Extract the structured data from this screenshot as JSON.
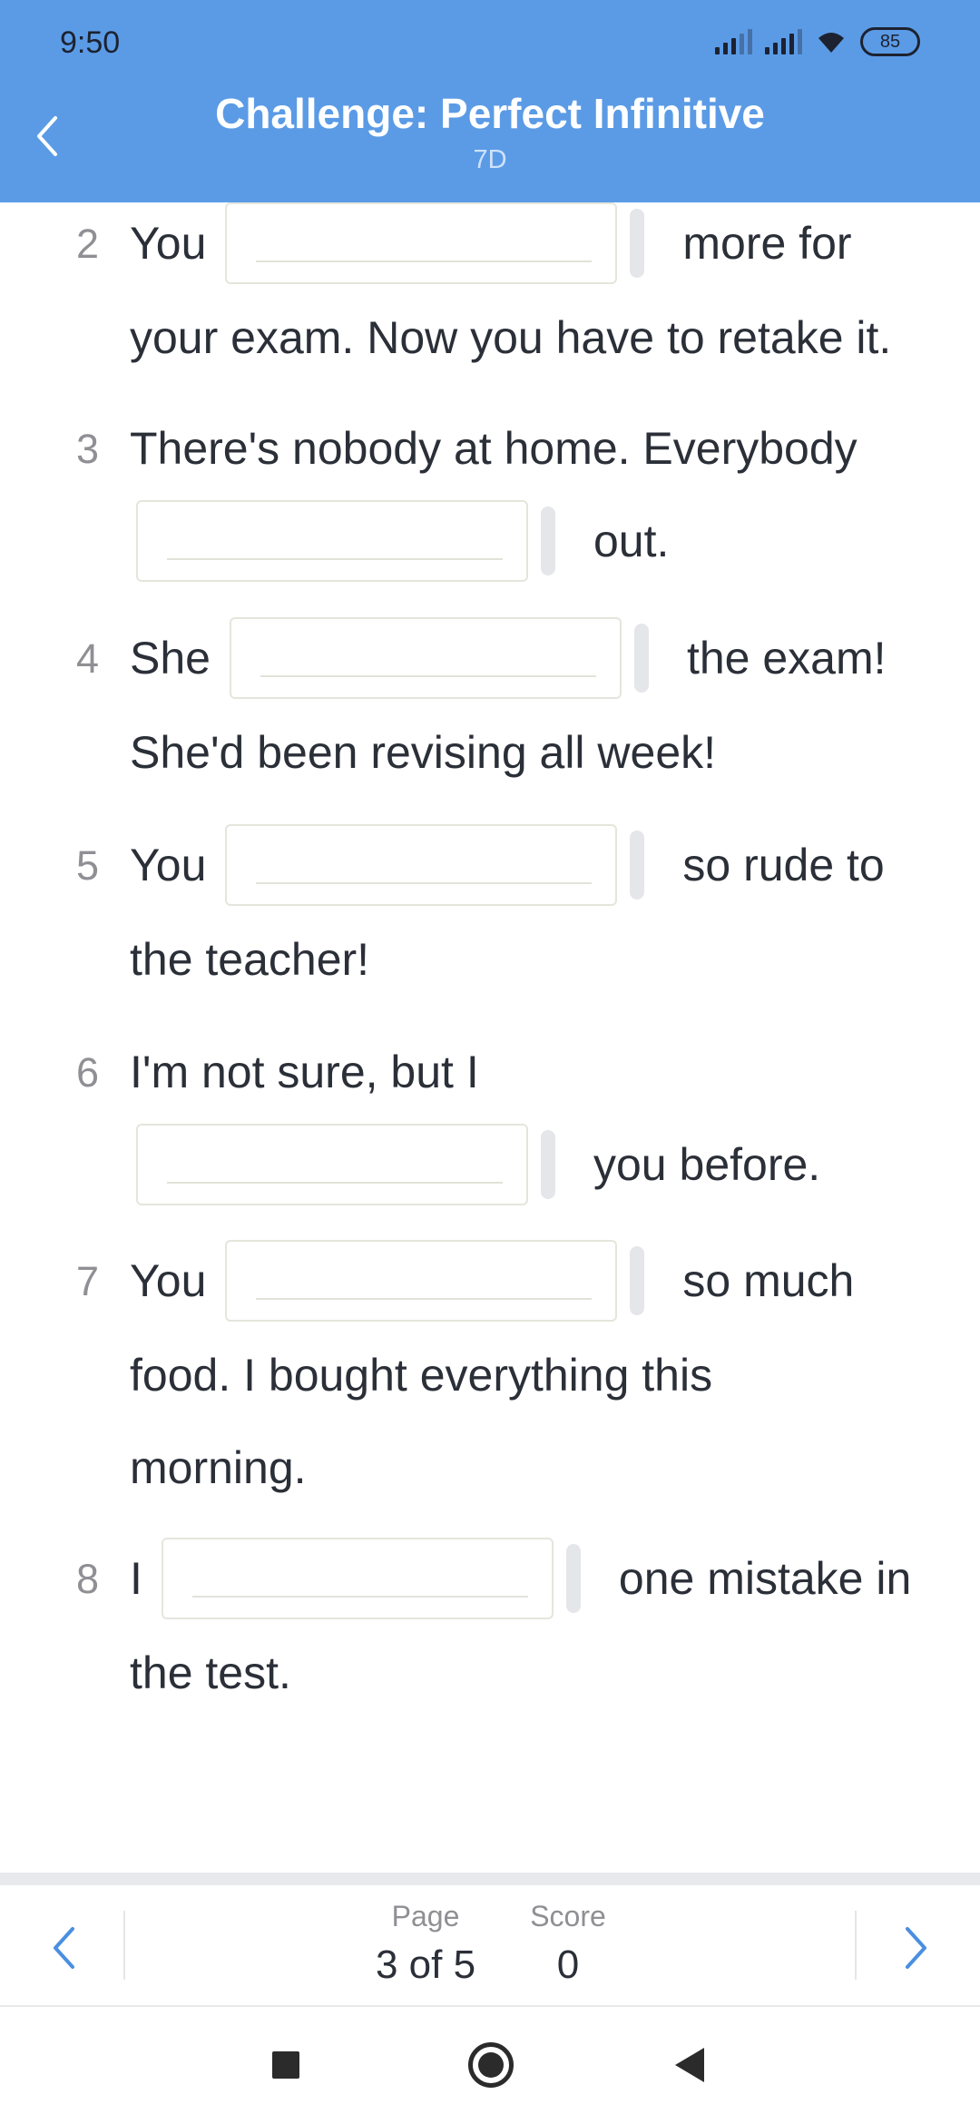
{
  "status_bar": {
    "time": "9:50",
    "battery": "85"
  },
  "header": {
    "title": "Challenge: Perfect Infinitive",
    "subtitle": "7D"
  },
  "questions": [
    {
      "num": "2",
      "pre": "You",
      "post": "more for",
      "rest": [
        "your exam. Now you have to retake it."
      ],
      "answer": ""
    },
    {
      "num": "3",
      "pre_lines": [
        "There's nobody at home. Everybody"
      ],
      "post": "out.",
      "answer": ""
    },
    {
      "num": "4",
      "pre": "She",
      "post": "the exam!",
      "rest": [
        "She'd been revising all week!"
      ],
      "answer": ""
    },
    {
      "num": "5",
      "pre": "You",
      "post": "so rude to",
      "rest": [
        "the teacher!"
      ],
      "answer": ""
    },
    {
      "num": "6",
      "pre_lines": [
        "I'm not sure, but I"
      ],
      "post": "you before.",
      "answer": ""
    },
    {
      "num": "7",
      "pre": "You",
      "post": "so much",
      "rest": [
        "food. I bought everything this",
        "morning."
      ],
      "answer": ""
    },
    {
      "num": "8",
      "pre": "I",
      "post": "one mistake in",
      "rest": [
        "the test."
      ],
      "answer": ""
    }
  ],
  "pager": {
    "page_label": "Page",
    "page_value": "3 of 5",
    "score_label": "Score",
    "score_value": "0"
  },
  "colors": {
    "header": "#5b9be6",
    "text": "#2b2f38",
    "muted": "#8f8f94",
    "accent": "#4a8fe0"
  }
}
